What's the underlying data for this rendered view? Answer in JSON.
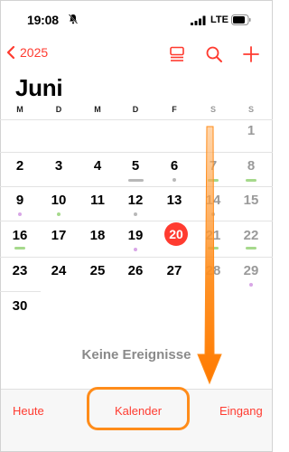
{
  "status_bar": {
    "time": "19:08",
    "network": "LTE"
  },
  "nav": {
    "back_label": "2025"
  },
  "month_title": "Juni",
  "weekdays": [
    "M",
    "D",
    "M",
    "D",
    "F",
    "S",
    "S"
  ],
  "days": {
    "d1": "1",
    "d2": "2",
    "d3": "3",
    "d4": "4",
    "d5": "5",
    "d6": "6",
    "d7": "7",
    "d8": "8",
    "d9": "9",
    "d10": "10",
    "d11": "11",
    "d12": "12",
    "d13": "13",
    "d14": "14",
    "d15": "15",
    "d16": "16",
    "d17": "17",
    "d18": "18",
    "d19": "19",
    "d20": "20",
    "d21": "21",
    "d22": "22",
    "d23": "23",
    "d24": "24",
    "d25": "25",
    "d26": "26",
    "d27": "27",
    "d28": "28",
    "d29": "29",
    "d30": "30"
  },
  "today": "20",
  "empty_state": "Keine Ereignisse",
  "tabs": {
    "today": "Heute",
    "calendars": "Kalender",
    "inbox": "Eingang"
  },
  "colors": {
    "accent": "#ff3b30",
    "annotation": "#ff8c1a",
    "event_green": "#a6d98c",
    "event_purple": "#d8a6e6",
    "event_gray": "#b8b8b8"
  },
  "icons": [
    "bell-slash-icon",
    "signal-icon",
    "battery-icon",
    "chevron-left-icon",
    "list-view-icon",
    "search-icon",
    "plus-icon"
  ]
}
